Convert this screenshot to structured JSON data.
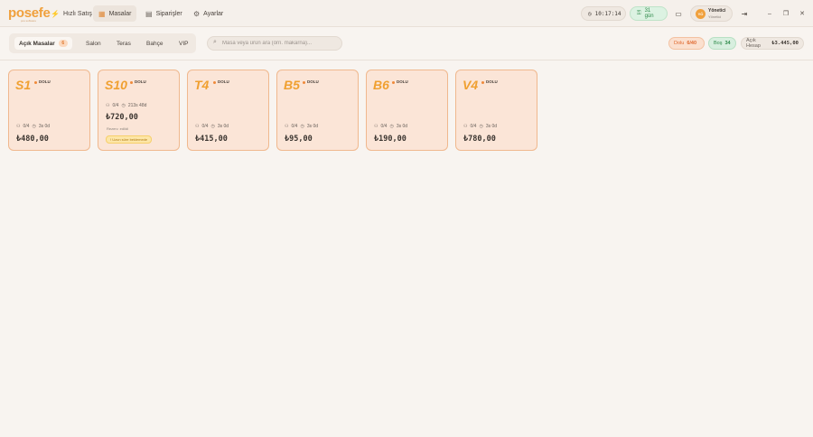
{
  "app": {
    "logo": "posefe",
    "logo_sub": "pos software"
  },
  "nav": [
    {
      "label": "Hızlı Satış",
      "icon": "lightning-icon"
    },
    {
      "label": "Masalar",
      "icon": "grid-icon",
      "active": true
    },
    {
      "label": "Siparişler",
      "icon": "clipboard-icon"
    },
    {
      "label": "Ayarlar",
      "icon": "gear-icon"
    }
  ],
  "header": {
    "clock": "10:17:14",
    "days": "31 gün",
    "user": {
      "initials": "YÖ",
      "name": "Yönetici",
      "role": "Yönetici"
    }
  },
  "filters": {
    "tabs": [
      {
        "label": "Açık Masalar",
        "count": "6",
        "active": true
      },
      {
        "label": "Salon"
      },
      {
        "label": "Teras"
      },
      {
        "label": "Bahçe"
      },
      {
        "label": "VIP"
      }
    ]
  },
  "search": {
    "placeholder": "Masa veya ürün ara (örn. makarna)..."
  },
  "stats": {
    "dolu_label": "Dolu",
    "dolu_value": "6/40",
    "bos_label": "Boş",
    "bos_value": "34",
    "acik_label": "Açık Hesap",
    "acik_value": "₺3.445,00"
  },
  "tables": [
    {
      "name": "S1",
      "status": "DOLU",
      "guests": "0/4",
      "time": "3s 0d",
      "amount": "₺480,00"
    },
    {
      "name": "S10",
      "status": "DOLU",
      "guests": "0/4",
      "time": "213s 48d",
      "amount": "₺720,00",
      "note": "Rezerv. edildi",
      "warning": "! Uzun süre beklemede"
    },
    {
      "name": "T4",
      "status": "DOLU",
      "guests": "0/4",
      "time": "3s 0d",
      "amount": "₺415,00"
    },
    {
      "name": "B5",
      "status": "DOLU",
      "guests": "0/4",
      "time": "3s 0d",
      "amount": "₺95,00"
    },
    {
      "name": "B6",
      "status": "DOLU",
      "guests": "0/4",
      "time": "3s 0d",
      "amount": "₺190,00"
    },
    {
      "name": "V4",
      "status": "DOLU",
      "guests": "0/4",
      "time": "3s 0d",
      "amount": "₺780,00"
    }
  ],
  "colors": {
    "accent": "#f0a03c",
    "card_bg": "#fbe5d7",
    "card_border": "#f0b88e"
  }
}
